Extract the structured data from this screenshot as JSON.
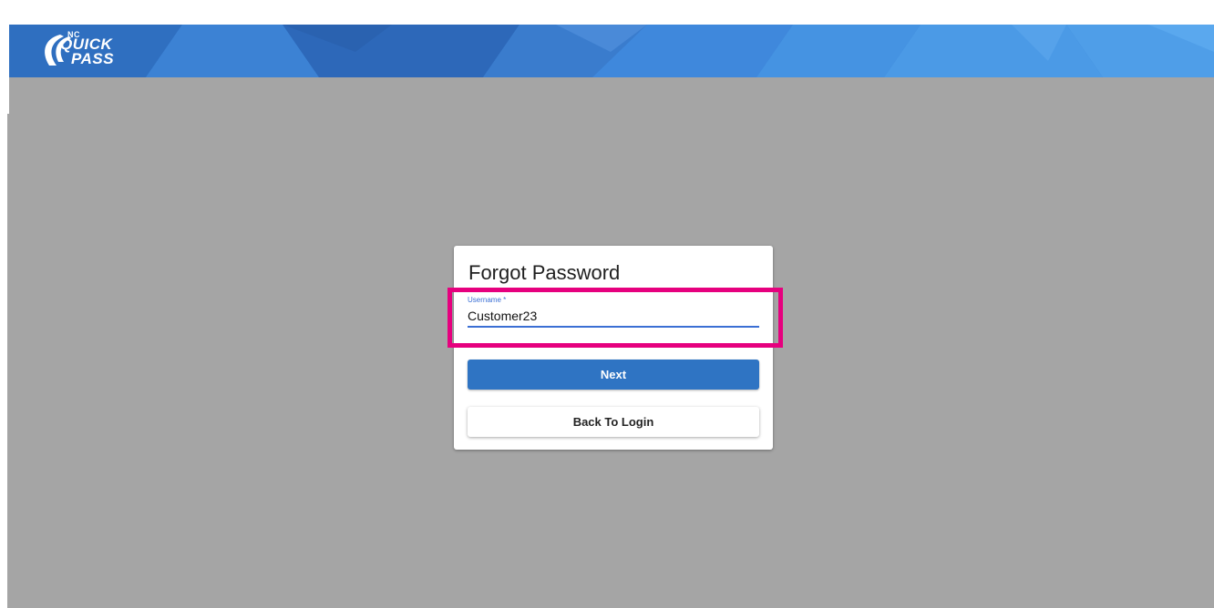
{
  "header": {
    "logo": {
      "line1": "NC",
      "line2": "QUICK",
      "line3": "PASS"
    }
  },
  "card": {
    "title": "Forgot Password",
    "username_field": {
      "label": "Username *",
      "value": "Customer23"
    },
    "next_label": "Next",
    "back_label": "Back To Login"
  },
  "colors": {
    "brand_blue": "#3a7fd0",
    "primary_button": "#2f74c3",
    "overlay_gray": "#a5a5a5",
    "highlight": "#e6007e",
    "field_accent": "#3b6fd4"
  }
}
